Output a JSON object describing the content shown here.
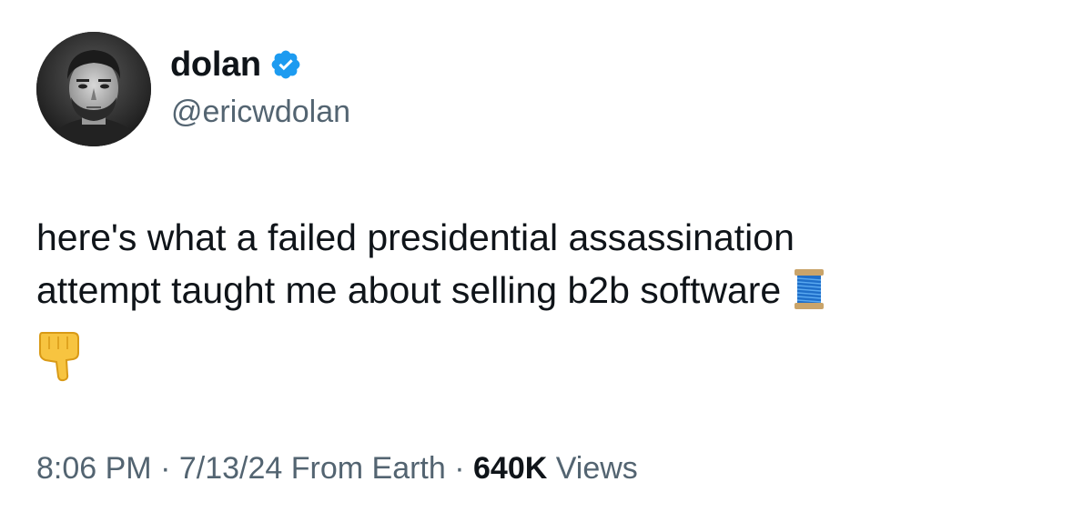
{
  "author": {
    "display_name": "dolan",
    "handle": "@ericwdolan",
    "verified": true
  },
  "tweet": {
    "text_line_1": "here's what a failed presidential assassination",
    "text_line_2": "attempt taught me about selling b2b software",
    "emoji_inline": "thread-icon",
    "emoji_below": "backhand-index-pointing-down-icon"
  },
  "meta": {
    "time": "8:06 PM",
    "separator_1": " · ",
    "date": "7/13/24",
    "location": " From Earth",
    "separator_2": " · ",
    "views_count": "640K",
    "views_label": " Views"
  },
  "colors": {
    "text": "#0f1419",
    "secondary": "#536471",
    "verified_blue": "#1d9bf0"
  }
}
